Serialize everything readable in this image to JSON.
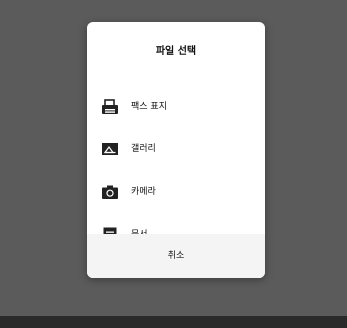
{
  "dialog": {
    "title": "파일 선택",
    "options": [
      {
        "label": "팩스 표지",
        "icon": "fax-icon"
      },
      {
        "label": "갤러리",
        "icon": "gallery-icon"
      },
      {
        "label": "카메라",
        "icon": "camera-icon"
      },
      {
        "label": "문서",
        "icon": "document-icon"
      }
    ],
    "cancel_label": "취소"
  },
  "colors": {
    "overlay": "#5b5b5b",
    "dialog_bg": "#ffffff",
    "cancel_bg": "#f4f4f4",
    "icon": "#222222"
  }
}
